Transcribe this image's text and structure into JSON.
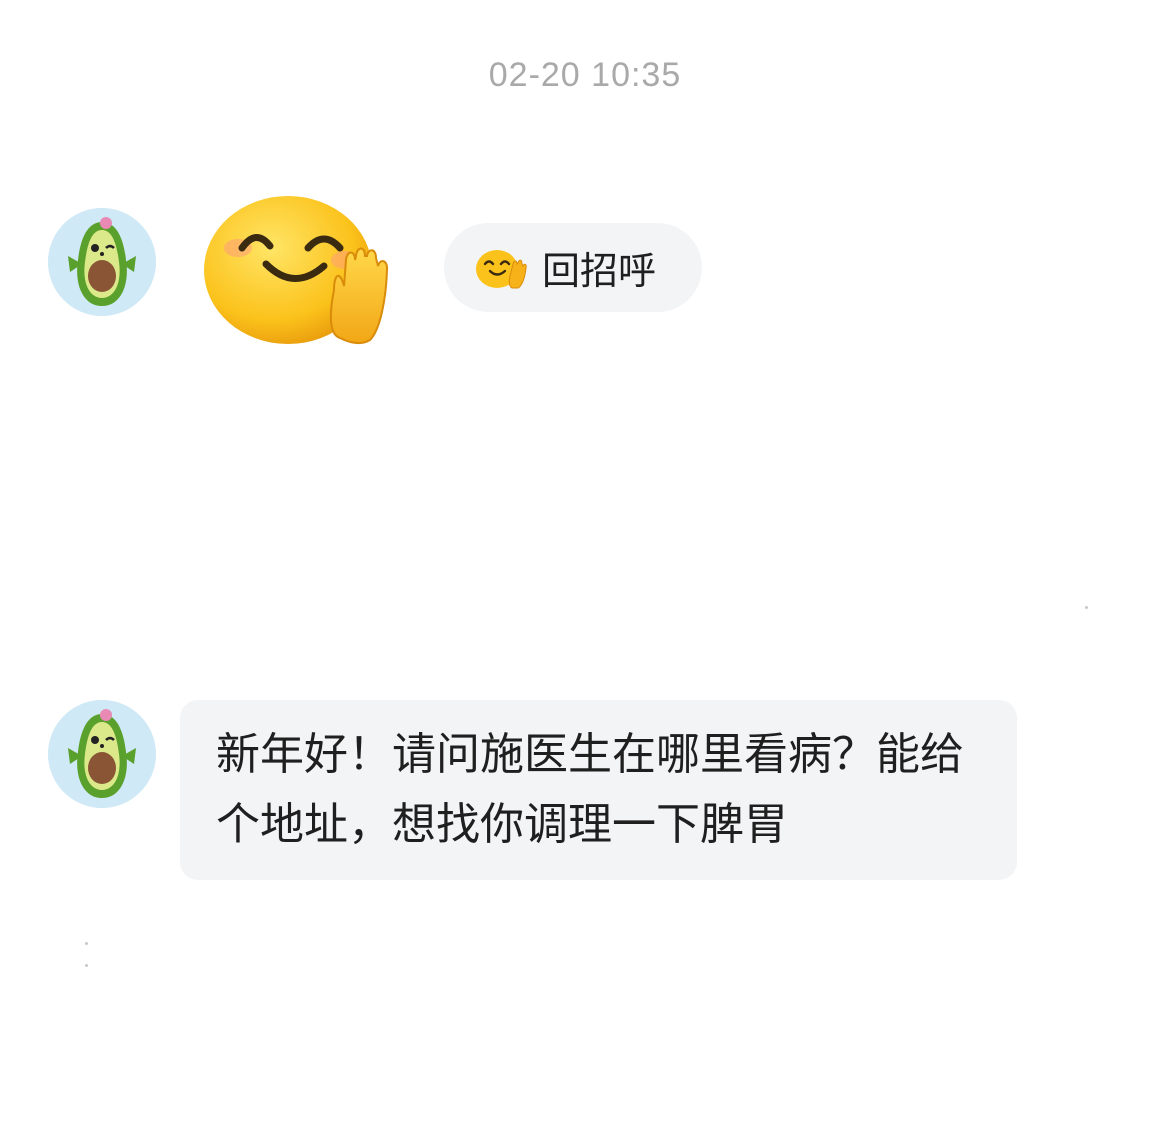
{
  "conversation": {
    "timestamp": "02-20 10:35",
    "messages": [
      {
        "sender_avatar": "avocado-avatar",
        "type": "sticker",
        "sticker": "waving-smile-emoji",
        "quick_reply": {
          "icon": "waving-smile-emoji",
          "label": "回招呼"
        }
      },
      {
        "sender_avatar": "avocado-avatar",
        "type": "text",
        "text": "新年好！请问施医生在哪里看病？能给个地址，想找你调理一下脾胃"
      }
    ]
  },
  "colors": {
    "background": "#ffffff",
    "bubble": "#f3f4f6",
    "timestamp": "#a9a9a9",
    "text": "#1f1f1f",
    "avatar_bg": "#cfe9f6"
  }
}
